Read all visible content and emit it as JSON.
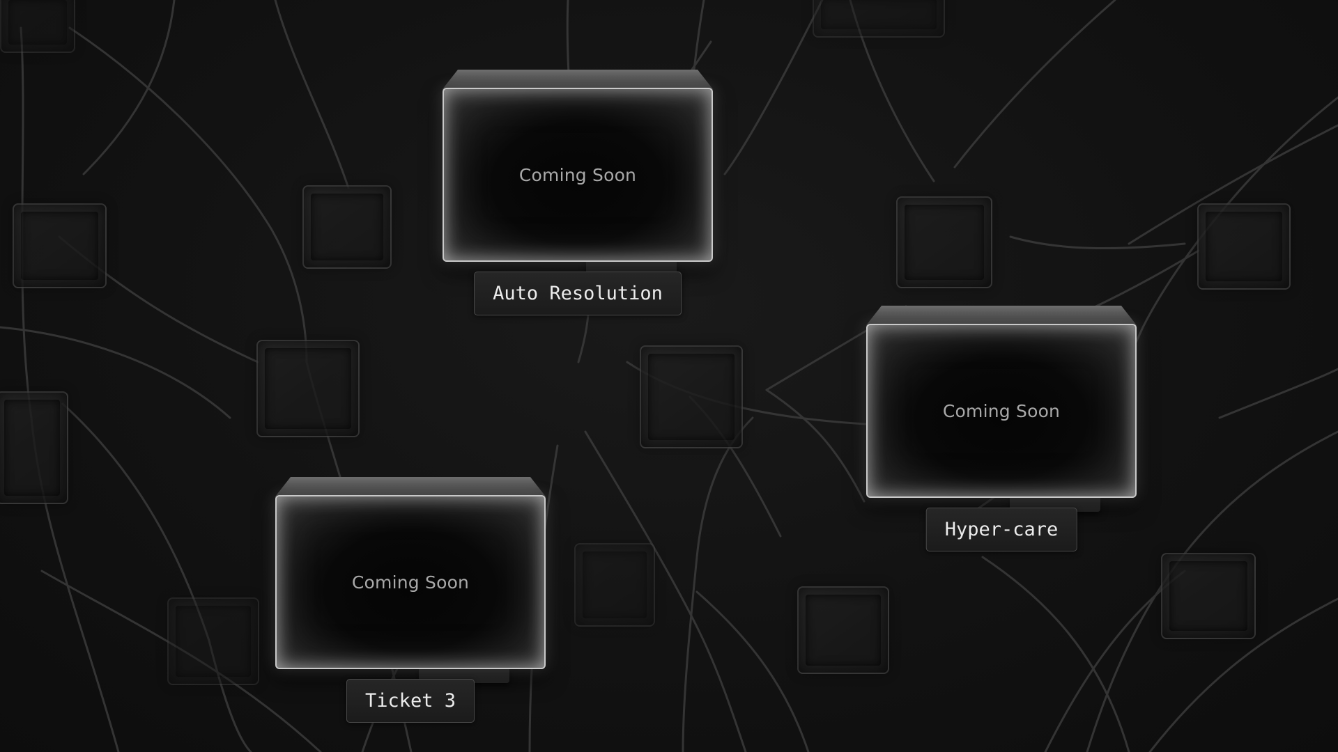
{
  "cards": [
    {
      "id": "auto-resolution",
      "body_text": "Coming Soon",
      "label": "Auto Resolution"
    },
    {
      "id": "hyper-care",
      "body_text": "Coming Soon",
      "label": "Hyper-care"
    },
    {
      "id": "ticket-3",
      "body_text": "Coming Soon",
      "label": "Ticket 3"
    }
  ],
  "colors": {
    "background": "#111111",
    "card_border": "#c9c9c9",
    "card_text": "#a9a9a9",
    "label_text": "#ececec"
  }
}
